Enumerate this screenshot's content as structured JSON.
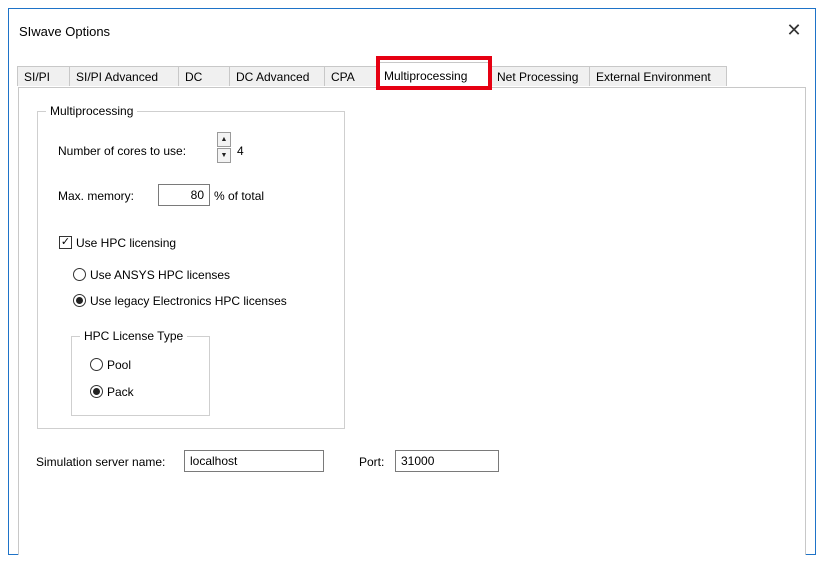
{
  "window": {
    "title": "SIwave Options",
    "close_glyph": "✕"
  },
  "tabs": [
    {
      "label": "SI/PI"
    },
    {
      "label": "SI/PI Advanced"
    },
    {
      "label": "DC"
    },
    {
      "label": "DC Advanced"
    },
    {
      "label": "CPA"
    },
    {
      "label": "Multiprocessing",
      "active": true
    },
    {
      "label": "Net Processing"
    },
    {
      "label": "External Environment"
    }
  ],
  "multiprocessing": {
    "legend": "Multiprocessing",
    "cores_label": "Number of cores to use:",
    "cores_value": "4",
    "memory_label": "Max. memory:",
    "memory_value": "80",
    "memory_suffix": "% of total",
    "hpc_checkbox_label": "Use HPC licensing",
    "hpc_checked": true,
    "radio_ansys": "Use ANSYS HPC licenses",
    "radio_legacy": "Use legacy Electronics HPC licenses",
    "license_type": {
      "legend": "HPC License Type",
      "pool": "Pool",
      "pack": "Pack"
    }
  },
  "server": {
    "name_label": "Simulation server name:",
    "name_value": "localhost",
    "port_label": "Port:",
    "port_value": "31000"
  },
  "colors": {
    "highlight": "#e60012",
    "window_border": "#1e73c8"
  },
  "icons": {
    "spin_up": "▲",
    "spin_down": "▼",
    "check": "✓"
  }
}
